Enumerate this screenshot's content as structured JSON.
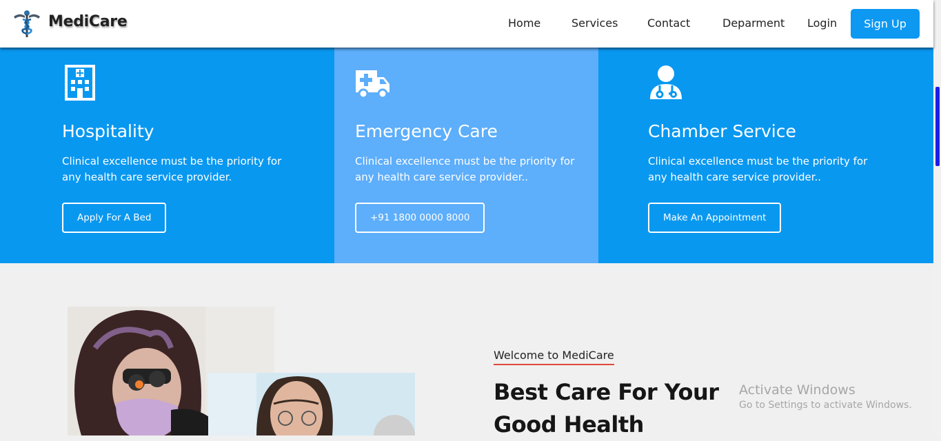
{
  "header": {
    "brand": "MediCare",
    "nav": [
      "Home",
      "Services",
      "Contact",
      "Deparment",
      "Login"
    ],
    "signup_label": "Sign Up"
  },
  "services": [
    {
      "icon": "hospital-building-icon",
      "title": "Hospitality",
      "text": "Clinical excellence must be the priority for any health care service provider.",
      "button": "Apply For A Bed"
    },
    {
      "icon": "ambulance-icon",
      "title": "Emergency Care",
      "text": "Clinical excellence must be the priority for any health care service provider..",
      "button": "+91 1800 0000 8000"
    },
    {
      "icon": "doctor-icon",
      "title": "Chamber Service",
      "text": "Clinical excellence must be the priority for any health care service provider..",
      "button": "Make An Appointment"
    }
  ],
  "welcome": {
    "tagline": "Welcome to MediCare",
    "headline": "Best Care For Your Good Health"
  },
  "os_watermark": {
    "title": "Activate Windows",
    "subtitle": "Go to Settings to activate Windows."
  },
  "colors": {
    "primary": "#0998f0",
    "panel_highlight": "#5daefb",
    "button": "#0d98f2",
    "underline": "#e0473a"
  }
}
